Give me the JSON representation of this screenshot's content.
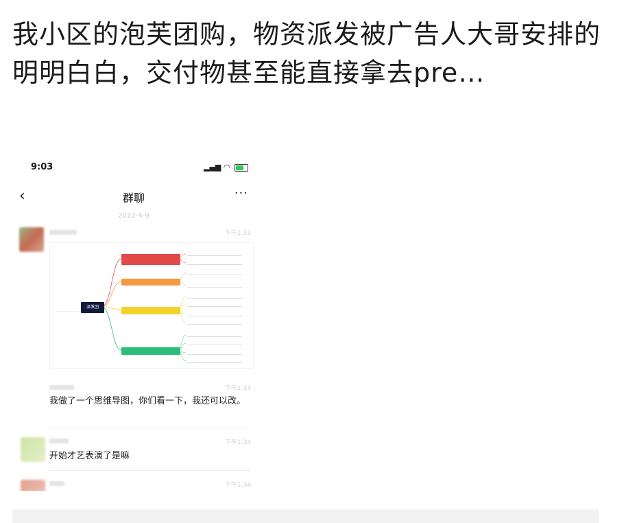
{
  "post": {
    "text": "我小区的泡芙团购，物资派发被广告人大哥安排的明明白白，交付物甚至能直接拿去pre…"
  },
  "screenshot": {
    "status": {
      "time": "9:03"
    },
    "nav": {
      "back": "‹",
      "title": "群聊",
      "more": "···"
    },
    "date": "2022-4-9",
    "messages": [
      {
        "time": "下午1:33",
        "type": "image"
      },
      {
        "time": "下午1:33",
        "text": "我做了一个思维导图，你们看一下，我还可以改。"
      },
      {
        "time": "下午1:34",
        "text": "开始才艺表演了是嘛"
      },
      {
        "time": "下午1:34",
        "text": ""
      }
    ],
    "mindmap": {
      "root": "派发团"
    }
  },
  "colors": {
    "mindmap_red": "#e24a4a",
    "mindmap_orange": "#f39a45",
    "mindmap_yellow": "#f2d22b",
    "mindmap_green": "#2dbd7a",
    "battery": "#34c759"
  }
}
